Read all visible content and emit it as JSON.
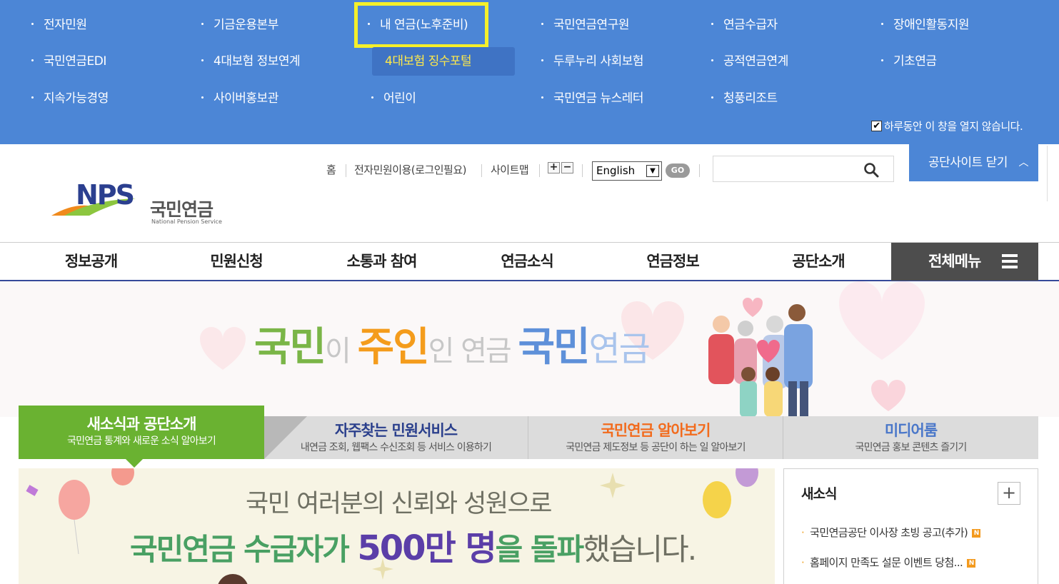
{
  "family_sites": {
    "links": [
      {
        "label": "전자민원"
      },
      {
        "label": "기금운용본부"
      },
      {
        "label": "내 연금(노후준비)"
      },
      {
        "label": "국민연금연구원"
      },
      {
        "label": "연금수급자"
      },
      {
        "label": "장애인활동지원"
      },
      {
        "label": "국민연금EDI"
      },
      {
        "label": "4대보험 정보연계"
      },
      {
        "label": "4대보험 징수포털"
      },
      {
        "label": "두루누리 사회보험"
      },
      {
        "label": "공적연금연계"
      },
      {
        "label": "기초연금"
      },
      {
        "label": "지속가능경영"
      },
      {
        "label": "사이버홍보관"
      },
      {
        "label": "어린이"
      },
      {
        "label": "국민연금 뉴스레터"
      },
      {
        "label": "청풍리조트"
      }
    ],
    "close_today_label": "하루동안 이 창을 열지 않습니다.",
    "close_today_checked": true
  },
  "header": {
    "logo_text": "NPS",
    "logo_ko": "국민연금",
    "logo_en": "National Pension Service",
    "util": {
      "home": "홈",
      "e_civil": "전자민원이용(로그인필요)",
      "sitemap": "사이트맵",
      "zoom_in": "+",
      "zoom_out": "−"
    },
    "language": {
      "selected": "English",
      "go": "GO"
    },
    "search": {
      "placeholder": ""
    },
    "close_site_button": "공단사이트 닫기"
  },
  "gnb": {
    "items": [
      "정보공개",
      "민원신청",
      "소통과 참여",
      "연금소식",
      "연금정보",
      "공단소개"
    ],
    "all_menu": "전체메뉴"
  },
  "banner": {
    "slogan": [
      "국민",
      "이 ",
      "주인",
      "인 연금 ",
      "국민",
      "연금"
    ]
  },
  "tabs": [
    {
      "title": "새소식과 공단소개",
      "sub": "국민연금 통계와 새로운 소식 알아보기",
      "color": "#ffffff"
    },
    {
      "title": "자주찾는 민원서비스",
      "sub": "내연금 조회, 웹팩스 수신조회 등 서비스 이용하기",
      "color": "#2a3f8c"
    },
    {
      "title": "국민연금 알아보기",
      "sub": "국민연금 제도정보 등 공단이 하는 일 알아보기",
      "color": "#f26b1d"
    },
    {
      "title": "미디어룸",
      "sub": "국민연금 홍보 콘텐츠 즐기기",
      "color": "#4a77c9"
    }
  ],
  "promo": {
    "line1": "국민 여러분의 신뢰와 성원으로",
    "line2_a": "국민연금 수급자가 ",
    "line2_num": "500만 명",
    "line2_b": "을 돌파",
    "line2_c": "했습니다."
  },
  "news": {
    "title": "새소식",
    "more": "+",
    "items": [
      {
        "text": "국민연금공단 이사장 초빙 공고(추가)",
        "badge": "N"
      },
      {
        "text": "홈페이지 만족도 설문 이벤트 당첨...",
        "badge": "N"
      }
    ]
  },
  "colors": {
    "panel_blue": "#4c86d6",
    "highlight_yellow": "#ffe94a",
    "gnb_border": "#364a9a",
    "active_tab_green": "#6ab231"
  }
}
